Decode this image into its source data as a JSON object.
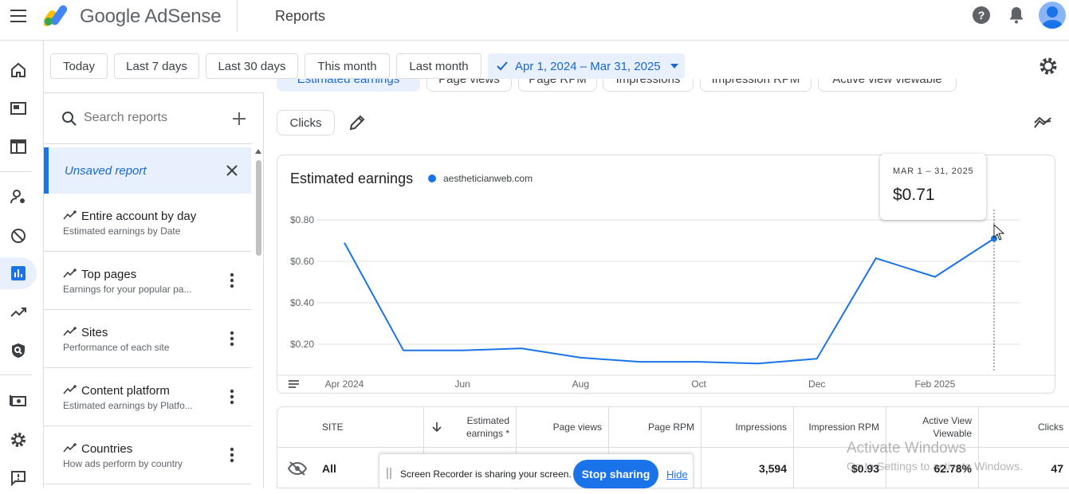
{
  "header": {
    "brand": "Google AdSense",
    "page_title": "Reports",
    "icons": [
      "menu-icon",
      "adsense-logo",
      "help-icon",
      "notifications-icon",
      "account-avatar"
    ]
  },
  "rail": {
    "items": [
      "home-icon",
      "ads-icon",
      "layout-icon",
      "user-settings-icon",
      "block-icon",
      "reports-icon",
      "trending-icon",
      "privacy-icon",
      "payments-icon",
      "settings-icon",
      "feedback-icon"
    ],
    "active": "reports-icon"
  },
  "date_filters": {
    "today": "Today",
    "last7": "Last 7 days",
    "last30": "Last 30 days",
    "this_month": "This month",
    "last_month": "Last month",
    "selected_range": "Apr 1, 2024 – Mar 31, 2025"
  },
  "sidebar": {
    "search_placeholder": "Search reports",
    "unsaved_label": "Unsaved report",
    "reports": [
      {
        "title": "Entire account by day",
        "subtitle": "Estimated earnings by Date",
        "has_menu": false
      },
      {
        "title": "Top pages",
        "subtitle": "Earnings for your popular pa...",
        "has_menu": true
      },
      {
        "title": "Sites",
        "subtitle": "Performance of each site",
        "has_menu": true
      },
      {
        "title": "Content platform",
        "subtitle": "Estimated earnings by Platfo...",
        "has_menu": true
      },
      {
        "title": "Countries",
        "subtitle": "How ads perform by country",
        "has_menu": true
      }
    ]
  },
  "metric_chips": {
    "estimated_earnings": "Estimated earnings",
    "page_views": "Page views",
    "page_rpm": "Page RPM",
    "impressions": "Impressions",
    "impression_rpm": "Impression RPM",
    "active_view": "Active view viewable",
    "clicks": "Clicks"
  },
  "chart_data": {
    "type": "line",
    "title": "Estimated earnings",
    "series": [
      {
        "name": "aestheticianweb.com",
        "color": "#1a73e8",
        "x": [
          "2024-04",
          "2024-05",
          "2024-06",
          "2024-07",
          "2024-08",
          "2024-09",
          "2024-10",
          "2024-11",
          "2024-12",
          "2025-01",
          "2025-02",
          "2025-03"
        ],
        "values": [
          0.69,
          0.17,
          0.17,
          0.18,
          0.135,
          0.115,
          0.115,
          0.107,
          0.13,
          0.615,
          0.525,
          0.71
        ]
      }
    ],
    "x_tick_labels": [
      "Apr 2024",
      "Jun",
      "Aug",
      "Oct",
      "Dec",
      "Feb 2025"
    ],
    "y_tick_labels": [
      "$0.80",
      "$0.60",
      "$0.40",
      "$0.20"
    ],
    "ylim": [
      0.05,
      0.85
    ],
    "grid": true,
    "legend_position": "top-left"
  },
  "tooltip": {
    "date": "MAR 1 – 31, 2025",
    "value": "$0.71"
  },
  "table": {
    "headers": {
      "site": "SITE",
      "earnings_line1": "Estimated",
      "earnings_line2": "earnings *",
      "page_views": "Page views",
      "page_rpm": "Page RPM",
      "impressions": "Impressions",
      "impression_rpm": "Impression RPM",
      "viewable_line1": "Active View",
      "viewable_line2": "Viewable",
      "clicks": "Clicks"
    },
    "total_row": {
      "site": "All",
      "impressions": "3,594",
      "impression_rpm": "$0.93",
      "viewable": "62.78%",
      "clicks": "47"
    }
  },
  "screen_share": {
    "message": "Screen Recorder is sharing your screen.",
    "stop": "Stop sharing",
    "hide": "Hide"
  },
  "watermark": {
    "title": "Activate Windows",
    "subtitle": "Go to Settings to activate Windows."
  }
}
